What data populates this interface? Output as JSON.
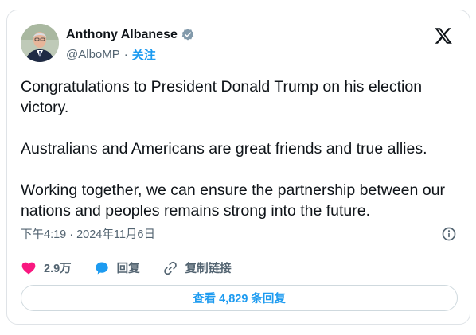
{
  "author": {
    "name": "Anthony Albanese",
    "handle": "@AlboMP",
    "separator": "·",
    "follow_label": "关注",
    "verified_icon": "verified-badge-icon",
    "avatar_icon": "avatar-photo"
  },
  "platform": {
    "logo_icon": "x-logo-icon"
  },
  "tweet": {
    "paragraphs": [
      "Congratulations to President Donald Trump on his election victory.",
      "Australians and Americans are great friends and true allies.",
      "Working together, we can ensure the partnership between our nations and peoples remains strong into the future."
    ],
    "timestamp": "下午4:19 · 2024年11月6日"
  },
  "actions": {
    "like_count": "2.9万",
    "reply_label": "回复",
    "copy_link_label": "复制链接"
  },
  "replies_button": {
    "label": "查看 4,829 条回复"
  },
  "colors": {
    "like": "#f91880",
    "reply": "#1d9bf0",
    "link": "#1d9bf0",
    "text": "#0f1419",
    "muted": "#536471",
    "verified": "#829aab"
  }
}
